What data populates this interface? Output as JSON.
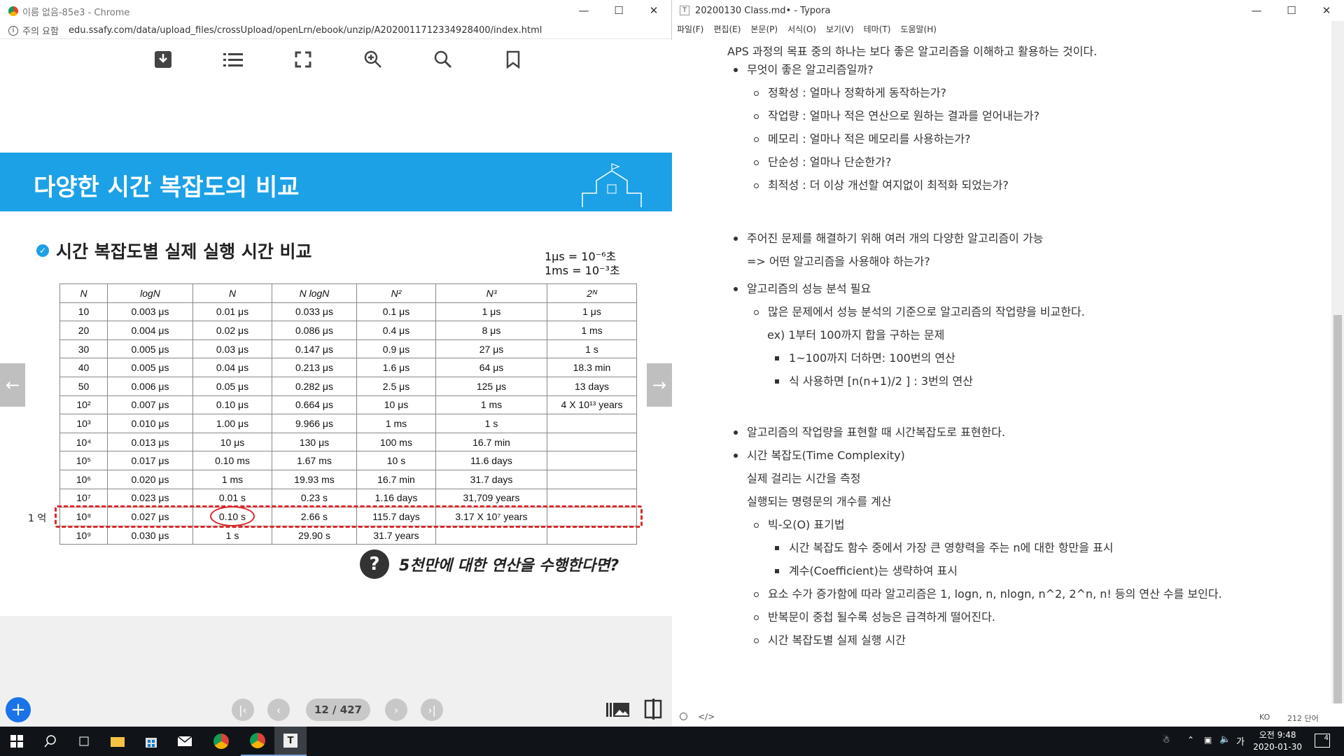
{
  "chrome": {
    "title": "이름 없음-85e3 - Chrome",
    "security": "주의 요함",
    "url": "edu.ssafy.com/data/upload_files/crossUpload/openLrn/ebook/unzip/A2020011712334928400/index.html"
  },
  "slide": {
    "banner": "다양한 시간 복잡도의 비교",
    "subtitle": "시간 복잡도별 실제 실행 시간 비교",
    "unit1": "1μs = 10⁻⁶초",
    "unit2": "1ms = 10⁻³초",
    "yeok": "1 억",
    "question": "5천만에 대한 연산을 수행한다면?",
    "headers": [
      "N",
      "logN",
      "N",
      "N logN",
      "N²",
      "N³",
      "2ᴺ"
    ],
    "rows": [
      [
        "10",
        "0.003 μs",
        "0.01 μs",
        "0.033 μs",
        "0.1 μs",
        "1 μs",
        "1 μs"
      ],
      [
        "20",
        "0.004 μs",
        "0.02 μs",
        "0.086 μs",
        "0.4 μs",
        "8 μs",
        "1 ms"
      ],
      [
        "30",
        "0.005 μs",
        "0.03 μs",
        "0.147 μs",
        "0.9 μs",
        "27 μs",
        "1 s"
      ],
      [
        "40",
        "0.005 μs",
        "0.04 μs",
        "0.213 μs",
        "1.6 μs",
        "64 μs",
        "18.3 min"
      ],
      [
        "50",
        "0.006 μs",
        "0.05 μs",
        "0.282 μs",
        "2.5 μs",
        "125 μs",
        "13 days"
      ],
      [
        "10²",
        "0.007 μs",
        "0.10 μs",
        "0.664 μs",
        "10 μs",
        "1 ms",
        "4 X 10¹³ years"
      ],
      [
        "10³",
        "0.010 μs",
        "1.00 μs",
        "9.966 μs",
        "1 ms",
        "1 s",
        ""
      ],
      [
        "10⁴",
        "0.013 μs",
        "10 μs",
        "130 μs",
        "100 ms",
        "16.7 min",
        ""
      ],
      [
        "10⁵",
        "0.017 μs",
        "0.10 ms",
        "1.67 ms",
        "10 s",
        "11.6 days",
        ""
      ],
      [
        "10⁶",
        "0.020 μs",
        "1 ms",
        "19.93 ms",
        "16.7 min",
        "31.7 days",
        ""
      ],
      [
        "10⁷",
        "0.023 μs",
        "0.01 s",
        "0.23 s",
        "1.16 days",
        "31,709 years",
        ""
      ],
      [
        "10⁸",
        "0.027 μs",
        "0.10 s",
        "2.66 s",
        "115.7 days",
        "3.17 X 10⁷ years",
        ""
      ],
      [
        "10⁹",
        "0.030 μs",
        "1 s",
        "29.90 s",
        "31.7 years",
        "",
        ""
      ]
    ],
    "pager": "12 / 427"
  },
  "typora": {
    "title": "20200130 Class.md• - Typora",
    "menu": [
      "파일(F)",
      "편집(E)",
      "본문(P)",
      "서식(O)",
      "보기(V)",
      "테마(T)",
      "도움말(H)"
    ],
    "lines": [
      "APS 과정의 목표 중의 하나는 보다 좋은 알고리즘을 이해하고 활용하는 것이다.",
      "무엇이 좋은 알고리즘일까?",
      "정확성 : 얼마나 정확하게 동작하는가?",
      "작업량 : 얼마나 적은 연산으로 원하는 결과를 얻어내는가?",
      "메모리 : 얼마나 적은 메모리를 사용하는가?",
      "단순성 : 얼마나 단순한가?",
      "최적성 : 더 이상 개선할 여지없이 최적화 되었는가?",
      "주어진 문제를 해결하기 위해 여러 개의 다양한 알고리즘이 가능",
      "=> 어떤 알고리즘을 사용해야 하는가?",
      "알고리즘의 성능 분석 필요",
      "많은 문제에서 성능 분석의 기준으로 알고리즘의 작업량을 비교한다.",
      "ex) 1부터 100까지 합을 구하는 문제",
      "1~100까지 더하면: 100번의 연산",
      "식 사용하면 [n(n+1)/2 ] : 3번의 연산",
      "알고리즘의 작업량을 표현할 때 시간복잡도로 표현한다.",
      "시간 복잡도(Time Complexity)",
      "실제 걸리는 시간을 측정",
      "실행되는 명령문의 개수를 계산",
      "빅-오(O) 표기법",
      "시간 복잡도 함수 중에서 가장 큰 영향력을 주는 n에 대한 항만을 표시",
      "계수(Coefficient)는 생략하여 표시",
      "요소 수가 증가함에 따라 알고리즘은 1, logn, n, nlogn, n^2, 2^n, n! 등의 연산 수를 보인다.",
      "반복문이 중첩 될수록 성능은 급격하게 떨어진다.",
      "시간 복잡도별 실제 실행 시간"
    ],
    "status_lang": "KO",
    "status_words": "212 단어"
  },
  "taskbar": {
    "time": "오전 9:48",
    "date": "2020-01-30",
    "ime": "가",
    "notif": "4"
  }
}
